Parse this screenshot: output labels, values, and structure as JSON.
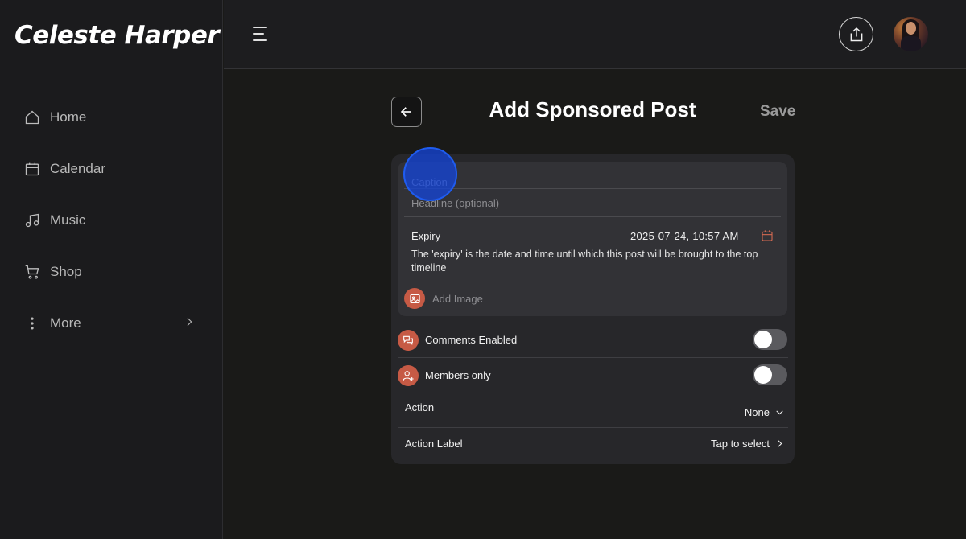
{
  "sidebar": {
    "brand": "Celeste Harper",
    "items": [
      {
        "label": "Home",
        "icon": "home-icon"
      },
      {
        "label": "Calendar",
        "icon": "calendar-icon"
      },
      {
        "label": "Music",
        "icon": "music-icon"
      },
      {
        "label": "Shop",
        "icon": "cart-icon"
      },
      {
        "label": "More",
        "icon": "more-vertical-icon"
      }
    ]
  },
  "topbar": {
    "menu_icon": "hamburger-menu-icon",
    "share_icon": "share-icon",
    "avatar": "user-avatar"
  },
  "header": {
    "title": "Add Sponsored Post",
    "save_label": "Save",
    "back_icon": "arrow-left-icon"
  },
  "form": {
    "caption_placeholder": "Caption",
    "headline_placeholder": "Headline (optional)",
    "expiry_label": "Expiry",
    "expiry_value": "2025-07-24, 10:57  AM",
    "expiry_help": "The 'expiry' is the date and time until which this post will be brought to the top timeline",
    "add_image_label": "Add Image",
    "comments_label": "Comments Enabled",
    "comments_enabled": false,
    "members_label": "Members only",
    "members_only": false,
    "action_label": "Action",
    "action_value": "None",
    "action_label_label": "Action Label",
    "action_label_value": "Tap to select"
  },
  "colors": {
    "accent": "#c65a45",
    "background": "#1a1a18",
    "card": "#27272a",
    "tap_indicator": "#1f5cf0"
  }
}
